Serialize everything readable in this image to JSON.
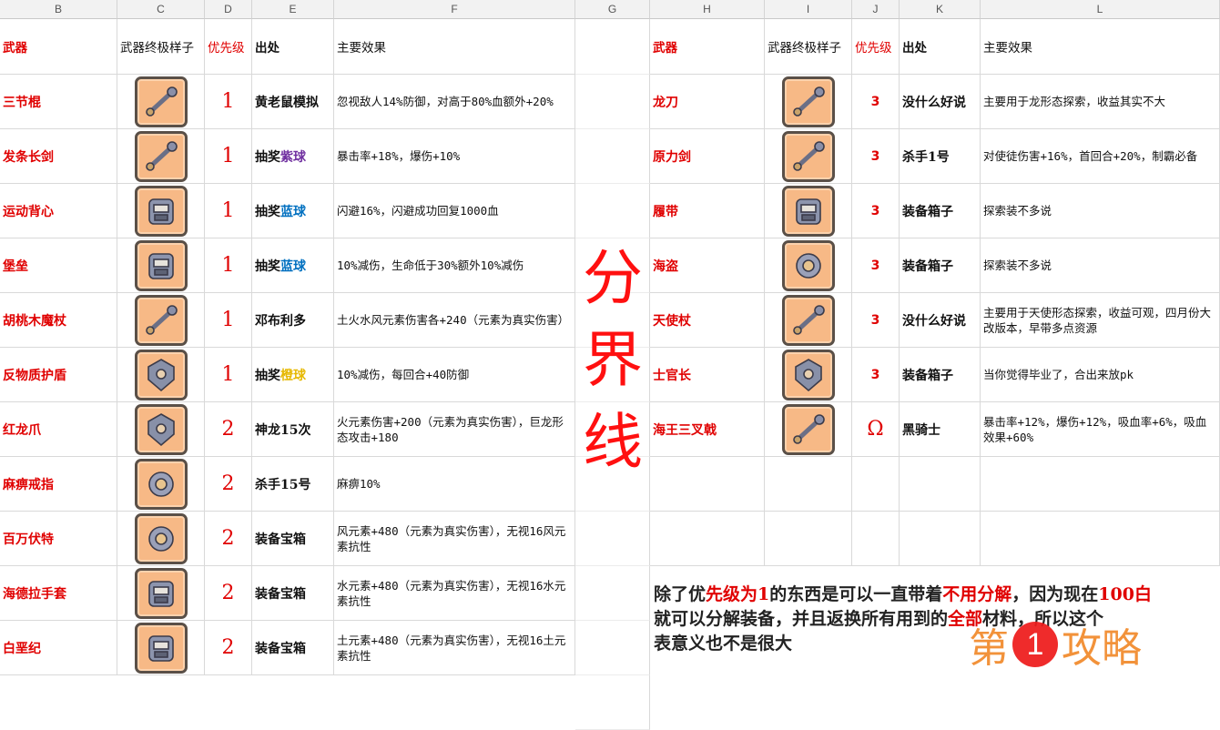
{
  "col_headers": [
    "B",
    "C",
    "D",
    "E",
    "F",
    "G",
    "H",
    "I",
    "J",
    "K",
    "L"
  ],
  "table_headers": {
    "weapon": "武器",
    "look": "武器终极样子",
    "priority": "优先级",
    "source": "出处",
    "effect": "主要效果"
  },
  "divider_text": [
    "分",
    "界",
    "线"
  ],
  "left_rows": [
    {
      "name": "三节棍",
      "priority": "1",
      "source": "黄老鼠模拟",
      "source_hl": "",
      "source_hl_color": "",
      "effect": "忽视敌人14%防御，对高于80%血额外+20%",
      "icon": "nunchaku-icon"
    },
    {
      "name": "发条长剑",
      "priority": "1",
      "source": "抽奖",
      "source_hl": "紫球",
      "source_hl_color": "#7030a0",
      "effect": "暴击率+18%，爆伤+10%",
      "icon": "clockwork-sword-icon"
    },
    {
      "name": "运动背心",
      "priority": "1",
      "source": "抽奖",
      "source_hl": "蓝球",
      "source_hl_color": "#0070c0",
      "effect": "闪避16%，闪避成功回复1000血",
      "icon": "vest-icon"
    },
    {
      "name": "堡垒",
      "priority": "1",
      "source": "抽奖",
      "source_hl": "蓝球",
      "source_hl_color": "#0070c0",
      "effect": "10%减伤，生命低于30%额外10%减伤",
      "icon": "fortress-icon"
    },
    {
      "name": "胡桃木魔杖",
      "priority": "1",
      "source": "邓布利多",
      "source_hl": "",
      "source_hl_color": "",
      "effect": "土火水风元素伤害各+240（元素为真实伤害）",
      "icon": "wand-icon"
    },
    {
      "name": "反物质护盾",
      "priority": "1",
      "source": "抽奖",
      "source_hl": "橙球",
      "source_hl_color": "#e6b800",
      "effect": "10%减伤，每回合+40防御",
      "icon": "shield-icon"
    },
    {
      "name": "红龙爪",
      "priority": "2",
      "source": "神龙15次",
      "source_hl": "",
      "source_hl_color": "",
      "effect": "火元素伤害+200（元素为真实伤害），巨龙形态攻击+180",
      "icon": "dragon-claw-icon"
    },
    {
      "name": "麻痹戒指",
      "priority": "2",
      "source": "杀手15号",
      "source_hl": "",
      "source_hl_color": "",
      "effect": "麻痹10%",
      "icon": "ring-icon"
    },
    {
      "name": "百万伏特",
      "priority": "2",
      "source": "装备宝箱",
      "source_hl": "",
      "source_hl_color": "",
      "effect": "风元素+480（元素为真实伤害），无视16风元素抗性",
      "icon": "volt-icon"
    },
    {
      "name": "海德拉手套",
      "priority": "2",
      "source": "装备宝箱",
      "source_hl": "",
      "source_hl_color": "",
      "effect": "水元素+480（元素为真实伤害），无视16水元素抗性",
      "icon": "glove-icon"
    },
    {
      "name": "白垩纪",
      "priority": "2",
      "source": "装备宝箱",
      "source_hl": "",
      "source_hl_color": "",
      "effect": "土元素+480（元素为真实伤害），无视16土元素抗性",
      "icon": "fossil-icon"
    }
  ],
  "right_rows": [
    {
      "name": "龙刀",
      "priority": "3",
      "source": "没什么好说",
      "effect": "主要用于龙形态探索，收益其实不大",
      "icon": "dragon-knife-icon"
    },
    {
      "name": "原力剑",
      "priority": "3",
      "source": "杀手1号",
      "effect": "对使徒伤害+16%，首回合+20%，制霸必备",
      "icon": "force-sword-icon"
    },
    {
      "name": "履带",
      "priority": "3",
      "source": "装备箱子",
      "effect": "探索装不多说",
      "icon": "track-icon"
    },
    {
      "name": "海盗",
      "priority": "3",
      "source": "装备箱子",
      "effect": "探索装不多说",
      "icon": "pirate-hook-icon"
    },
    {
      "name": "天使杖",
      "priority": "3",
      "source": "没什么好说",
      "effect": "主要用于天使形态探索，收益可观，四月份大改版本，早带多点资源",
      "icon": "angel-staff-icon"
    },
    {
      "name": "士官长",
      "priority": "3",
      "source": "装备箱子",
      "effect": "当你觉得毕业了，合出来放pk",
      "icon": "sergeant-icon"
    },
    {
      "name": "海王三叉戟",
      "priority": "Ω",
      "source": "黑骑士",
      "effect": "暴击率+12%，爆伤+12%，吸血率+6%，吸血效果+60%",
      "icon": "trident-icon"
    }
  ],
  "note": {
    "p1": "除了优",
    "h1": "先级为1",
    "p2": "的东西是可以一直带着",
    "h2": "不用分解",
    "p3": "，因为现在",
    "h3": "100白",
    "line2a": "就可以分解装备，并且返换所有用到的",
    "h4": "全部",
    "line2b": "材料，所以这个",
    "line3": "表意义也不是很大"
  },
  "watermark": {
    "left": "第",
    "num": "1",
    "right": "攻略"
  },
  "colors": {
    "red": "#e00000",
    "icon_bg": "#f7b986",
    "divider": "#ff1010",
    "watermark": "#f28a2c"
  }
}
